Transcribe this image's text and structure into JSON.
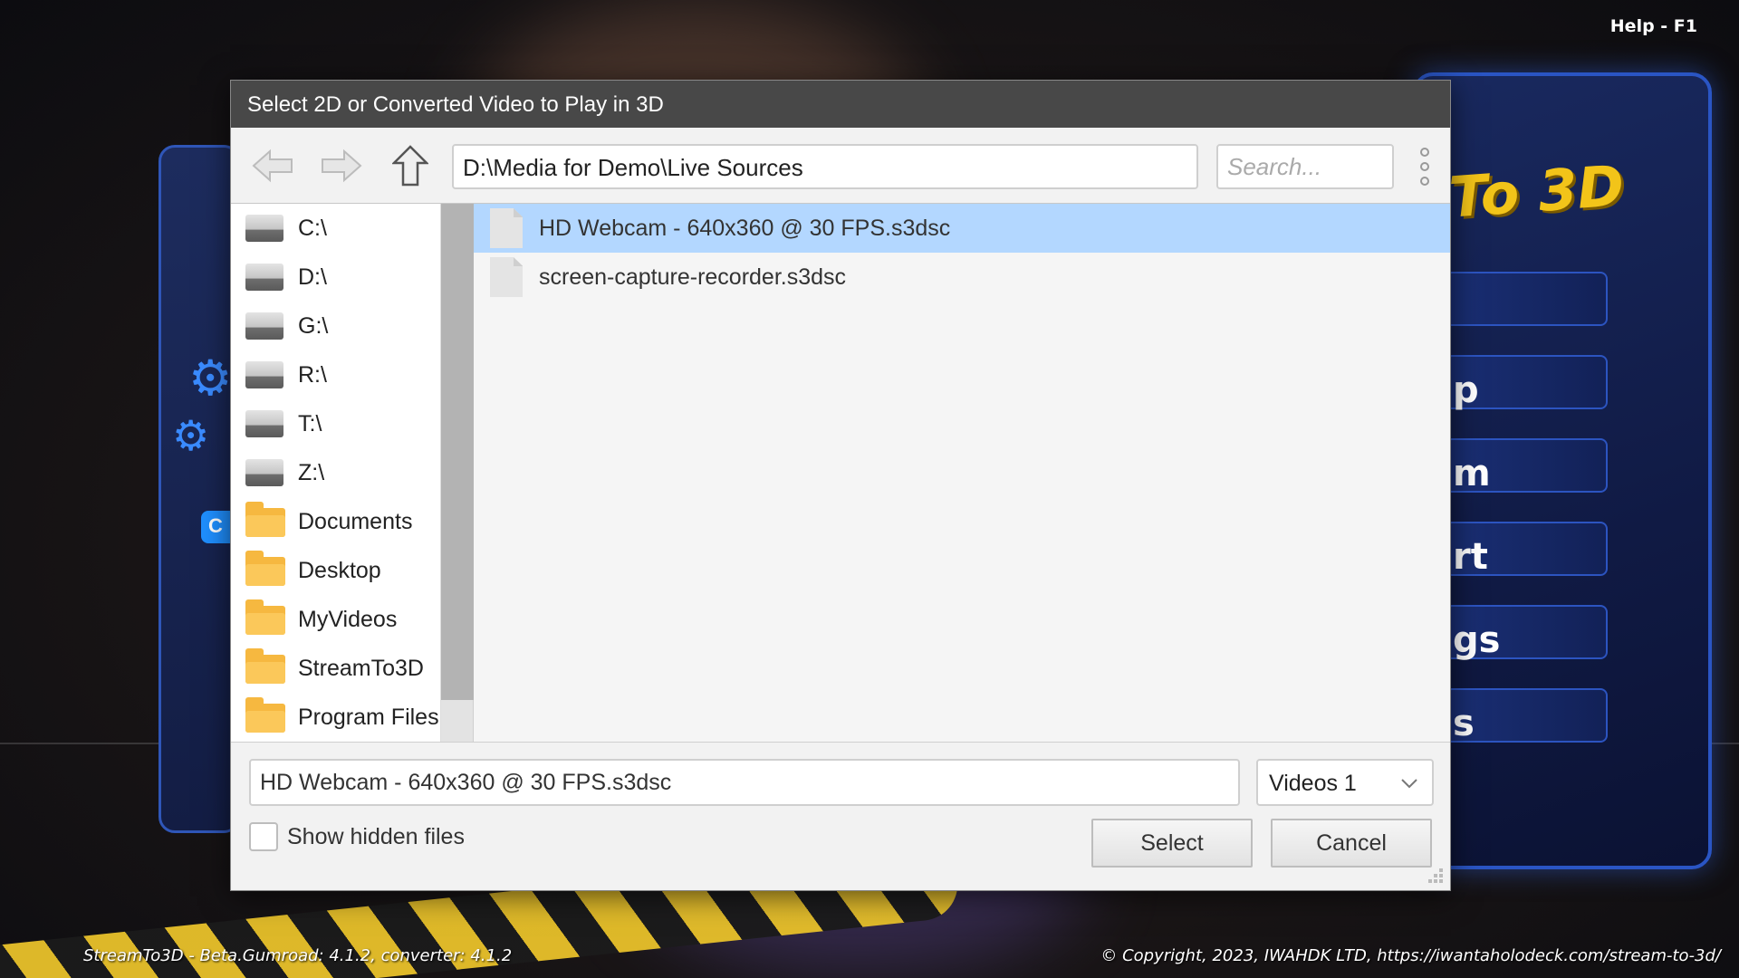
{
  "background": {
    "help_label": "Help - F1",
    "logo_text": "To 3D",
    "menu_fragments": [
      "p",
      "m",
      "rt",
      "gs",
      "s"
    ],
    "badge_text": "C",
    "footer_left": "StreamTo3D - Beta.Gumroad: 4.1.2, converter: 4.1.2",
    "footer_right": "© Copyright, 2023, IWAHDK LTD, https://iwantaholodeck.com/stream-to-3d/"
  },
  "dialog": {
    "title": "Select 2D or Converted Video to Play in 3D",
    "path": "D:\\Media for Demo\\Live Sources",
    "search_placeholder": "Search...",
    "sidebar": [
      {
        "label": "C:\\",
        "icon": "drive-icon"
      },
      {
        "label": "D:\\",
        "icon": "drive-icon"
      },
      {
        "label": "G:\\",
        "icon": "drive-icon"
      },
      {
        "label": "R:\\",
        "icon": "drive-icon"
      },
      {
        "label": "T:\\",
        "icon": "drive-icon"
      },
      {
        "label": "Z:\\",
        "icon": "drive-icon"
      },
      {
        "label": "Documents",
        "icon": "folder-icon"
      },
      {
        "label": "Desktop",
        "icon": "folder-icon"
      },
      {
        "label": "MyVideos",
        "icon": "folder-icon"
      },
      {
        "label": "StreamTo3D",
        "icon": "folder-icon"
      },
      {
        "label": "Program Files",
        "icon": "folder-icon"
      }
    ],
    "files": [
      {
        "name": "HD Webcam - 640x360 @ 30 FPS.s3dsc",
        "selected": true
      },
      {
        "name": "screen-capture-recorder.s3dsc",
        "selected": false
      }
    ],
    "filename_value": "HD Webcam - 640x360 @ 30 FPS.s3dsc",
    "filter_selected": "Videos 1",
    "show_hidden_label": "Show hidden files",
    "select_label": "Select",
    "cancel_label": "Cancel"
  },
  "colors": {
    "titlebar": "#484848",
    "selection": "#b3d7ff",
    "folder": "#f6b840",
    "accent_blue": "#2a55c4",
    "logo_yellow": "#f2c419"
  }
}
